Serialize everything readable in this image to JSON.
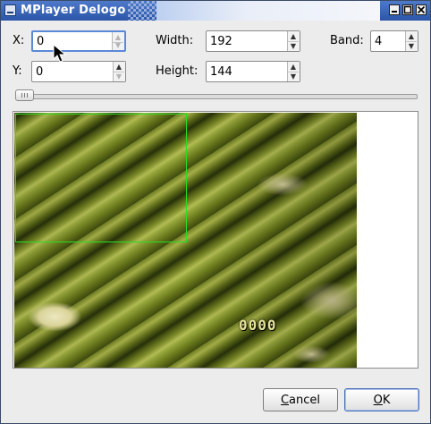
{
  "window": {
    "title": "MPlayer Delogo",
    "buttons": {
      "minimize": "▭",
      "maximize": "□",
      "close": "✕"
    }
  },
  "fields": {
    "x": {
      "label": "X:",
      "value": "0"
    },
    "y": {
      "label": "Y:",
      "value": "0"
    },
    "width": {
      "label": "Width:",
      "value": "192"
    },
    "height": {
      "label": "Height:",
      "value": "144"
    },
    "band": {
      "label": "Band:",
      "value": "4"
    }
  },
  "slider": {
    "value": 0
  },
  "preview": {
    "overlay_text": "0000"
  },
  "buttons": {
    "cancel": {
      "mnemonic": "C",
      "rest": "ancel"
    },
    "ok": {
      "mnemonic": "O",
      "rest": "K"
    }
  },
  "colors": {
    "titlebar": "#2b56a8",
    "logo_rect": "#2bdc22",
    "focus": "#5b88d8"
  }
}
